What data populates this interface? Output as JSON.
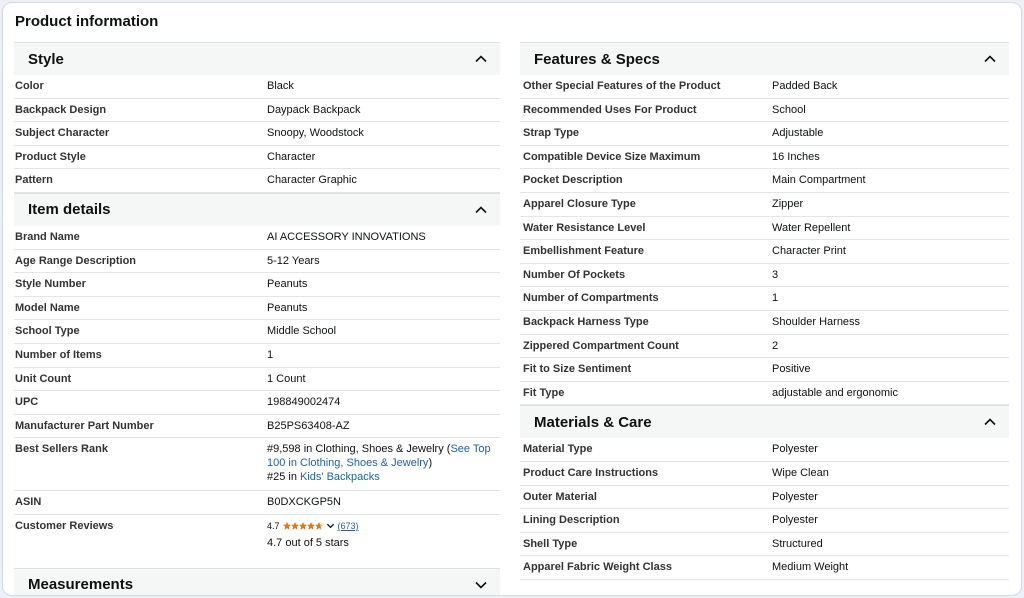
{
  "page_title": "Product information",
  "left": {
    "style": {
      "title": "Style",
      "rows": [
        {
          "k": "Color",
          "v": "Black"
        },
        {
          "k": "Backpack Design",
          "v": "Daypack Backpack"
        },
        {
          "k": "Subject Character",
          "v": "Snoopy, Woodstock"
        },
        {
          "k": "Product Style",
          "v": "Character"
        },
        {
          "k": "Pattern",
          "v": "Character Graphic"
        }
      ]
    },
    "item": {
      "title": "Item details",
      "rows": [
        {
          "k": "Brand Name",
          "v": "AI ACCESSORY INNOVATIONS"
        },
        {
          "k": "Age Range Description",
          "v": "5-12 Years"
        },
        {
          "k": "Style Number",
          "v": "Peanuts"
        },
        {
          "k": "Model Name",
          "v": "Peanuts"
        },
        {
          "k": "School Type",
          "v": "Middle School"
        },
        {
          "k": "Number of Items",
          "v": "1"
        },
        {
          "k": "Unit Count",
          "v": "1 Count"
        },
        {
          "k": "UPC",
          "v": "198849002474"
        },
        {
          "k": "Manufacturer Part Number",
          "v": "B25PS63408-AZ"
        }
      ],
      "bsr": {
        "k": "Best Sellers Rank",
        "line1_pre": "#9,598 in Clothing, Shoes & Jewelry (",
        "line1_link": "See Top 100 in Clothing, Shoes & Jewelry",
        "line1_post": ")",
        "line2_pre": "#25 in ",
        "line2_link": "Kids' Backpacks"
      },
      "asin": {
        "k": "ASIN",
        "v": "B0DXCKGP5N"
      },
      "reviews": {
        "k": "Customer Reviews",
        "rating": "4.7",
        "stars": 4.7,
        "count": "(673)",
        "out_of": "4.7 out of 5 stars"
      }
    },
    "measurements": {
      "title": "Measurements"
    }
  },
  "right": {
    "features": {
      "title": "Features & Specs",
      "rows": [
        {
          "k": "Other Special Features of the Product",
          "v": "Padded Back"
        },
        {
          "k": "Recommended Uses For Product",
          "v": "School"
        },
        {
          "k": "Strap Type",
          "v": "Adjustable"
        },
        {
          "k": "Compatible Device Size Maximum",
          "v": "16 Inches"
        },
        {
          "k": "Pocket Description",
          "v": "Main Compartment"
        },
        {
          "k": "Apparel Closure Type",
          "v": "Zipper"
        },
        {
          "k": "Water Resistance Level",
          "v": "Water Repellent"
        },
        {
          "k": "Embellishment Feature",
          "v": "Character Print"
        },
        {
          "k": "Number Of Pockets",
          "v": "3"
        },
        {
          "k": "Number of Compartments",
          "v": "1"
        },
        {
          "k": "Backpack Harness Type",
          "v": "Shoulder Harness"
        },
        {
          "k": "Zippered Compartment Count",
          "v": "2"
        },
        {
          "k": "Fit to Size Sentiment",
          "v": "Positive"
        },
        {
          "k": "Fit Type",
          "v": "adjustable and ergonomic"
        }
      ]
    },
    "materials": {
      "title": "Materials & Care",
      "rows": [
        {
          "k": "Material Type",
          "v": "Polyester"
        },
        {
          "k": "Product Care Instructions",
          "v": "Wipe Clean"
        },
        {
          "k": "Outer Material",
          "v": "Polyester"
        },
        {
          "k": "Lining Description",
          "v": "Polyester"
        },
        {
          "k": "Shell Type",
          "v": "Structured"
        },
        {
          "k": "Apparel Fabric Weight Class",
          "v": "Medium Weight"
        }
      ]
    }
  },
  "icons": {
    "collapse": "chevron-up-icon",
    "expand": "chevron-down-icon",
    "star": "star-icon"
  },
  "colors": {
    "link": "#2162a1",
    "star": "#de7921",
    "section_bg": "#f5f6f6"
  }
}
